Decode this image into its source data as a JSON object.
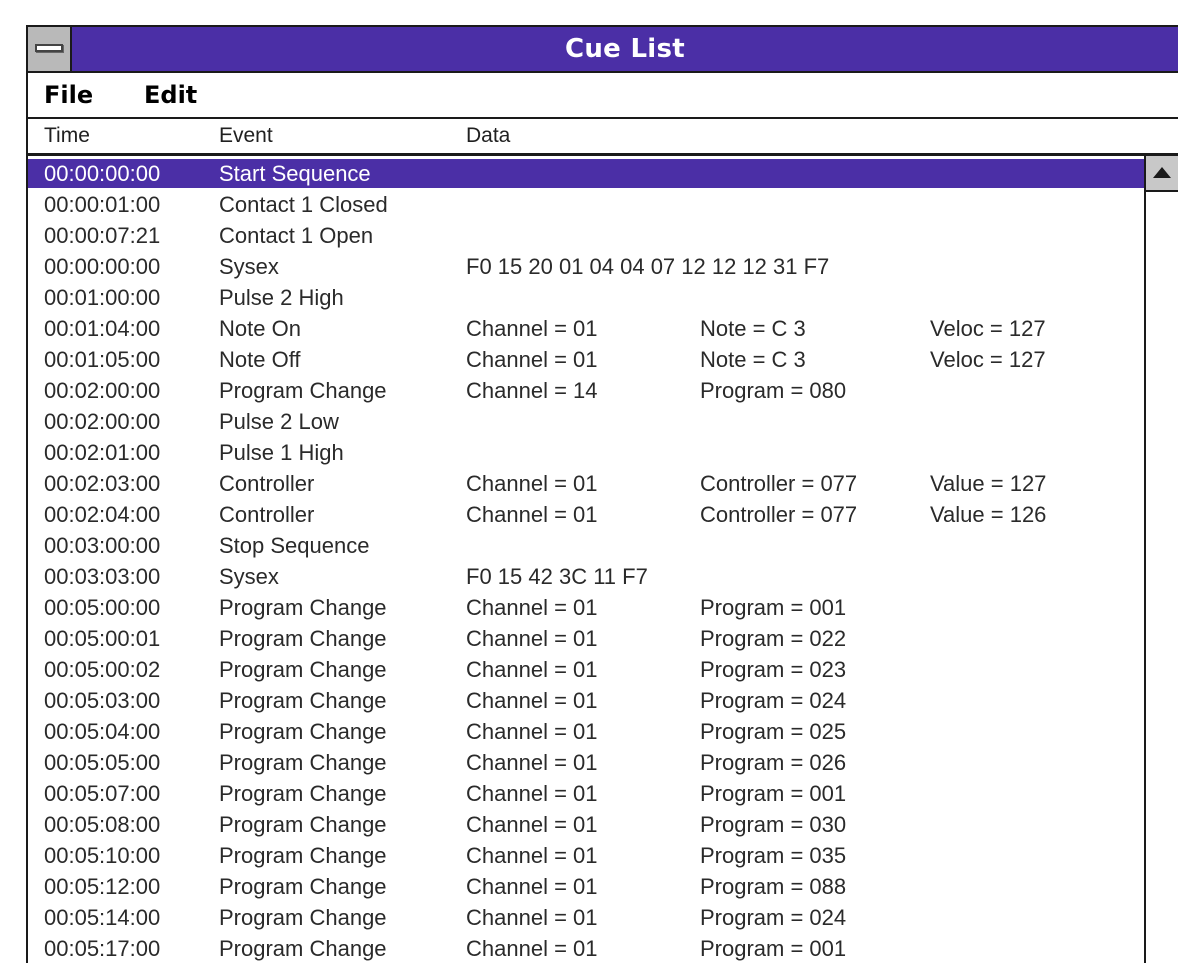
{
  "window": {
    "title": "Cue List"
  },
  "menu": {
    "file": "File",
    "edit": "Edit"
  },
  "columns": {
    "time": "Time",
    "event": "Event",
    "data": "Data"
  },
  "rows": [
    {
      "time": "00:00:00:00",
      "event": "Start Sequence",
      "d1": "",
      "d2": "",
      "d3": "",
      "selected": true
    },
    {
      "time": "00:00:01:00",
      "event": "Contact 1 Closed",
      "d1": "",
      "d2": "",
      "d3": ""
    },
    {
      "time": "00:00:07:21",
      "event": "Contact 1 Open",
      "d1": "",
      "d2": "",
      "d3": ""
    },
    {
      "time": "00:00:00:00",
      "event": "Sysex",
      "d1": "F0 15 20 01 04 04 07 12 12 12 31 F7",
      "d2": "",
      "d3": ""
    },
    {
      "time": "00:01:00:00",
      "event": "Pulse 2 High",
      "d1": "",
      "d2": "",
      "d3": ""
    },
    {
      "time": "00:01:04:00",
      "event": "Note On",
      "d1": "Channel = 01",
      "d2": "Note = C 3",
      "d3": "Veloc = 127"
    },
    {
      "time": "00:01:05:00",
      "event": "Note Off",
      "d1": "Channel = 01",
      "d2": "Note = C 3",
      "d3": "Veloc = 127"
    },
    {
      "time": "00:02:00:00",
      "event": "Program Change",
      "d1": "Channel = 14",
      "d2": "Program = 080",
      "d3": ""
    },
    {
      "time": "00:02:00:00",
      "event": "Pulse 2 Low",
      "d1": "",
      "d2": "",
      "d3": ""
    },
    {
      "time": "00:02:01:00",
      "event": "Pulse 1 High",
      "d1": "",
      "d2": "",
      "d3": ""
    },
    {
      "time": "00:02:03:00",
      "event": "Controller",
      "d1": "Channel = 01",
      "d2": "Controller = 077",
      "d3": "Value = 127"
    },
    {
      "time": "00:02:04:00",
      "event": "Controller",
      "d1": "Channel = 01",
      "d2": "Controller = 077",
      "d3": "Value = 126"
    },
    {
      "time": "00:03:00:00",
      "event": "Stop Sequence",
      "d1": "",
      "d2": "",
      "d3": ""
    },
    {
      "time": "00:03:03:00",
      "event": "Sysex",
      "d1": "F0 15 42 3C 11 F7",
      "d2": "",
      "d3": ""
    },
    {
      "time": "00:05:00:00",
      "event": "Program Change",
      "d1": "Channel = 01",
      "d2": "Program = 001",
      "d3": ""
    },
    {
      "time": "00:05:00:01",
      "event": "Program Change",
      "d1": "Channel = 01",
      "d2": "Program = 022",
      "d3": ""
    },
    {
      "time": "00:05:00:02",
      "event": "Program Change",
      "d1": "Channel = 01",
      "d2": "Program = 023",
      "d3": ""
    },
    {
      "time": "00:05:03:00",
      "event": "Program Change",
      "d1": "Channel = 01",
      "d2": "Program = 024",
      "d3": ""
    },
    {
      "time": "00:05:04:00",
      "event": "Program Change",
      "d1": "Channel = 01",
      "d2": "Program = 025",
      "d3": ""
    },
    {
      "time": "00:05:05:00",
      "event": "Program Change",
      "d1": "Channel = 01",
      "d2": "Program = 026",
      "d3": ""
    },
    {
      "time": "00:05:07:00",
      "event": "Program Change",
      "d1": "Channel = 01",
      "d2": "Program = 001",
      "d3": ""
    },
    {
      "time": "00:05:08:00",
      "event": "Program Change",
      "d1": "Channel = 01",
      "d2": "Program = 030",
      "d3": ""
    },
    {
      "time": "00:05:10:00",
      "event": "Program Change",
      "d1": "Channel = 01",
      "d2": "Program = 035",
      "d3": ""
    },
    {
      "time": "00:05:12:00",
      "event": "Program Change",
      "d1": "Channel = 01",
      "d2": "Program = 088",
      "d3": ""
    },
    {
      "time": "00:05:14:00",
      "event": "Program Change",
      "d1": "Channel = 01",
      "d2": "Program = 024",
      "d3": ""
    },
    {
      "time": "00:05:17:00",
      "event": "Program Change",
      "d1": "Channel = 01",
      "d2": "Program = 001",
      "d3": ""
    }
  ],
  "colors": {
    "titlebar": "#4b2fa6",
    "selection": "#4b2fa6",
    "text": "#2a2a2a"
  },
  "icons": {
    "system_menu": "system-menu-icon",
    "scroll_up": "scroll-up-arrow-icon"
  }
}
